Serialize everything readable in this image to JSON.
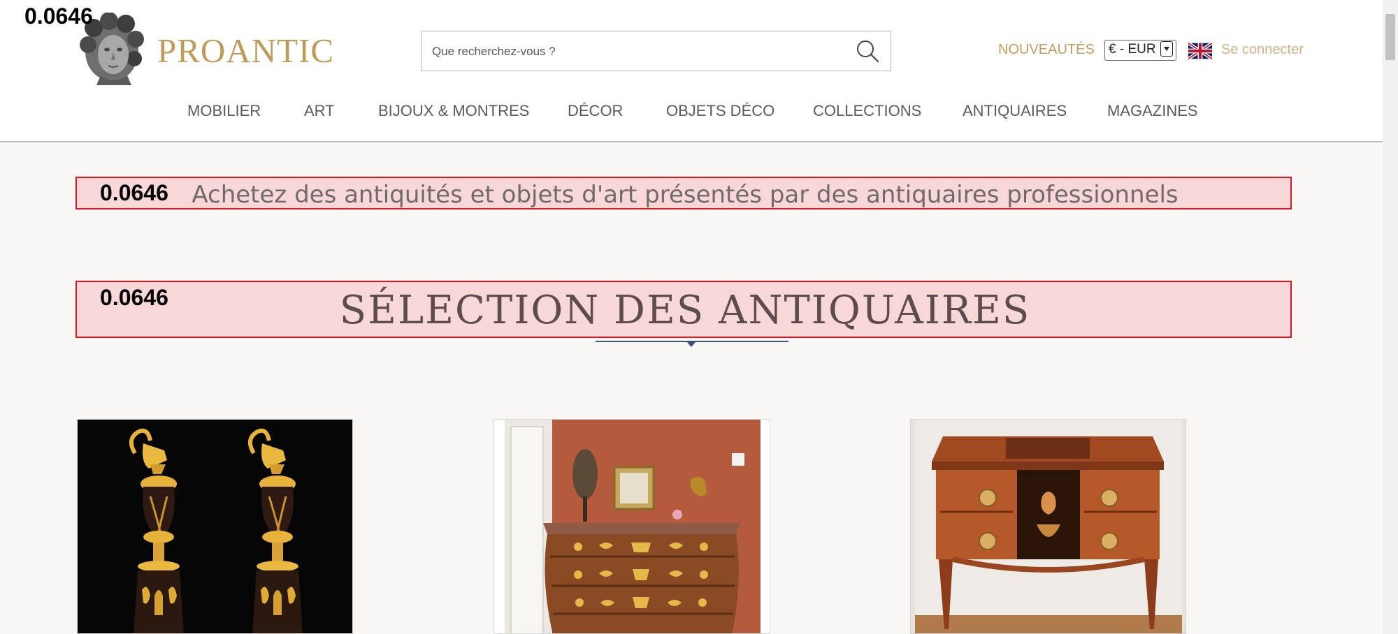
{
  "scores": [
    "0.0646",
    "0.0646",
    "0.0646"
  ],
  "brand": {
    "name": "PROANTIC"
  },
  "search": {
    "placeholder": "Que recherchez-vous ?"
  },
  "header": {
    "new_label": "NOUVEAUTÉS",
    "currency": "€ - EUR",
    "login_label": "Se connecter"
  },
  "nav": [
    "MOBILIER",
    "ART",
    "BIJOUX & MONTRES",
    "DÉCOR",
    "OBJETS DÉCO",
    "COLLECTIONS",
    "ANTIQUAIRES",
    "MAGAZINES"
  ],
  "tagline": "Achetez des antiquités et objets d'art présentés par des antiquaires professionnels",
  "section_title": "SÉLECTION DES ANTIQUAIRES",
  "products": [
    {
      "icon": "bronze-ewers-image"
    },
    {
      "icon": "chest-of-drawers-image"
    },
    {
      "icon": "marquetry-commode-image"
    }
  ],
  "colors": {
    "brand": "#bf9b5a",
    "highlight_fill": "#f8d7d9",
    "highlight_border": "#e0161e",
    "nav_text": "#5a5a5a"
  }
}
